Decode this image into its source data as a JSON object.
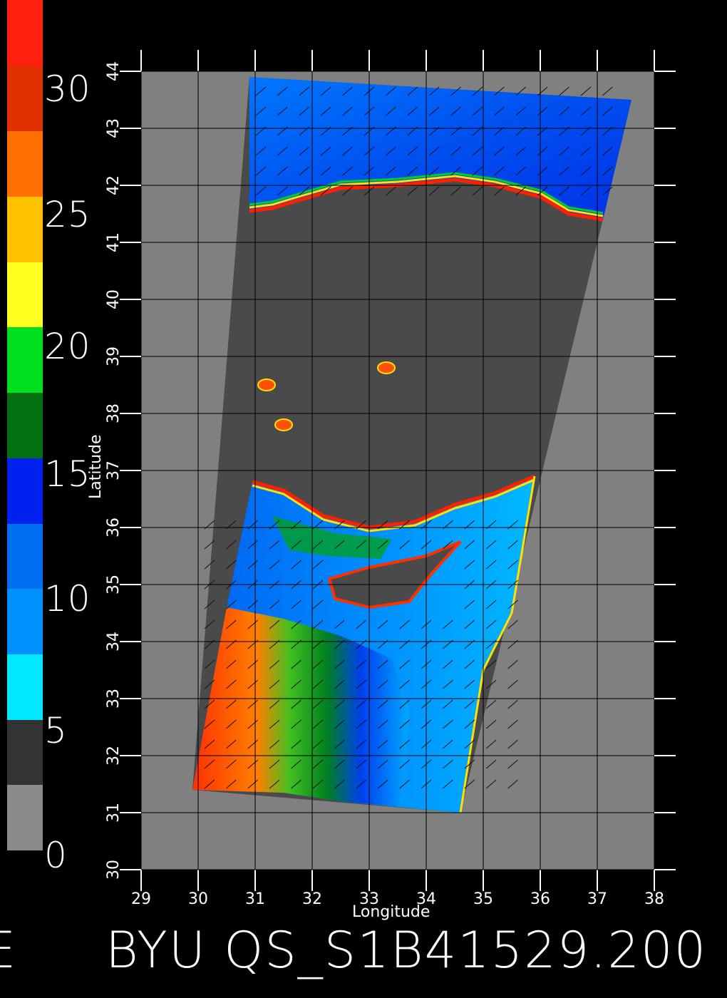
{
  "colorbar": {
    "labels": [
      "30",
      "25",
      "20",
      "15",
      "10",
      "5",
      "0"
    ],
    "segments": [
      {
        "from": 0,
        "to": 2.5,
        "color": "#8a8a8a"
      },
      {
        "from": 2.5,
        "to": 5,
        "color": "#333333"
      },
      {
        "from": 5,
        "to": 7.5,
        "color": "#00e8ff"
      },
      {
        "from": 7.5,
        "to": 10,
        "color": "#0090ff"
      },
      {
        "from": 10,
        "to": 12.5,
        "color": "#0070f0"
      },
      {
        "from": 12.5,
        "to": 15,
        "color": "#0020f0"
      },
      {
        "from": 15,
        "to": 17.5,
        "color": "#007010"
      },
      {
        "from": 17.5,
        "to": 20,
        "color": "#00e020"
      },
      {
        "from": 20,
        "to": 22.5,
        "color": "#ffff20"
      },
      {
        "from": 22.5,
        "to": 25,
        "color": "#ffc000"
      },
      {
        "from": 25,
        "to": 27.5,
        "color": "#ff7000"
      },
      {
        "from": 27.5,
        "to": 30,
        "color": "#e03000"
      },
      {
        "from": 30,
        "to": 32.5,
        "color": "#ff2010"
      }
    ]
  },
  "map": {
    "xlabel": "Longitude",
    "ylabel": "Latitude",
    "x_ticks": [
      "29",
      "30",
      "31",
      "32",
      "33",
      "34",
      "35",
      "36",
      "37",
      "38"
    ],
    "y_ticks": [
      "30",
      "31",
      "32",
      "33",
      "34",
      "35",
      "36",
      "37",
      "38",
      "39",
      "40",
      "41",
      "42",
      "43",
      "44"
    ],
    "lon_range": [
      29,
      38
    ],
    "lat_range": [
      30,
      44
    ],
    "background_color": "#808080",
    "land_color": "#4a4a4a",
    "swath_corners_lonlat": [
      [
        30.9,
        43.9
      ],
      [
        37.6,
        43.5
      ],
      [
        34.6,
        31.0
      ],
      [
        29.9,
        31.4
      ]
    ]
  },
  "footer": {
    "text": "BYU QS_S1B41529.200",
    "left_fragment": "E"
  }
}
